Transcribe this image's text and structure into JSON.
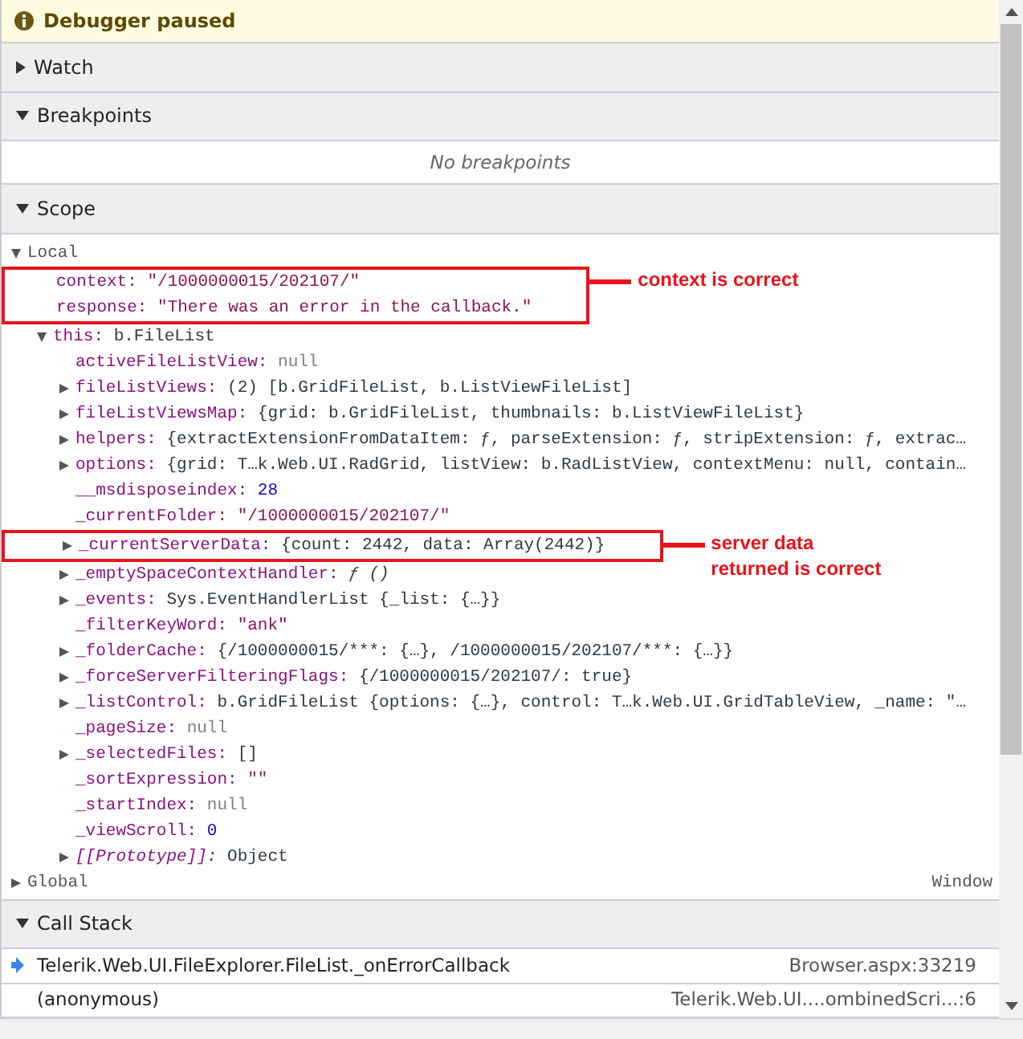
{
  "banner": {
    "text": "Debugger paused"
  },
  "sections": [
    {
      "kind": "watch",
      "title": "Watch",
      "expanded": false
    },
    {
      "kind": "breakpoints",
      "title": "Breakpoints",
      "expanded": true,
      "empty_message": "No breakpoints"
    },
    {
      "kind": "scope",
      "title": "Scope",
      "expanded": true,
      "scopes": [
        {
          "name": "Local",
          "expanded": true,
          "children": [
            {
              "kind": "callout",
              "note": [
                "context is correct"
              ],
              "children": [
                {
                  "kind": "string",
                  "name": "context:",
                  "value": "\"/1000000015/202107/\""
                },
                {
                  "kind": "string",
                  "name": "response:",
                  "value": "\"There was an error in the callback.\""
                }
              ]
            },
            {
              "kind": "object",
              "name": "this:",
              "value": "b.FileList",
              "expanded": true,
              "children": [
                {
                  "kind": "null",
                  "name": "activeFileListView:",
                  "value": "null"
                },
                {
                  "kind": "object",
                  "name": "fileListViews:",
                  "value": "(2) [b.GridFileList, b.ListViewFileList]",
                  "expanded": false
                },
                {
                  "kind": "object",
                  "name": "fileListViewsMap:",
                  "value": "{grid: b.GridFileList, thumbnails: b.ListViewFileList}",
                  "expanded": false
                },
                {
                  "kind": "object",
                  "name": "helpers:",
                  "value": "{extractExtensionFromDataItem: ƒ, parseExtension: ƒ, stripExtension: ƒ, extrac…",
                  "expanded": false
                },
                {
                  "kind": "object",
                  "name": "options:",
                  "value": "{grid: T…k.Web.UI.RadGrid, listView: b.RadListView, contextMenu: null, contain…",
                  "expanded": false
                },
                {
                  "kind": "number",
                  "name": "__msdisposeindex:",
                  "value": "28"
                },
                {
                  "kind": "string",
                  "name": "_currentFolder:",
                  "value": "\"/1000000015/202107/\""
                },
                {
                  "kind": "callout",
                  "note": [
                    "server data",
                    "returned is correct"
                  ],
                  "children": [
                    {
                      "kind": "object",
                      "name": "_currentServerData:",
                      "value": "{count: 2442, data: Array(2442)}",
                      "expanded": false
                    }
                  ]
                },
                {
                  "kind": "function",
                  "name": "_emptySpaceContextHandler:",
                  "value": "ƒ ()",
                  "expanded": false
                },
                {
                  "kind": "object",
                  "name": "_events:",
                  "value": "Sys.EventHandlerList {_list: {…}}",
                  "expanded": false
                },
                {
                  "kind": "string",
                  "name": "_filterKeyWord:",
                  "value": "\"ank\""
                },
                {
                  "kind": "object",
                  "name": "_folderCache:",
                  "value": "{/1000000015/***: {…}, /1000000015/202107/***: {…}}",
                  "expanded": false
                },
                {
                  "kind": "object",
                  "name": "_forceServerFilteringFlags:",
                  "value": "{/1000000015/202107/: true}",
                  "expanded": false
                },
                {
                  "kind": "object",
                  "name": "_listControl:",
                  "value": "b.GridFileList {options: {…}, control: T…k.Web.UI.GridTableView, _name: \"…",
                  "expanded": false
                },
                {
                  "kind": "null",
                  "name": "_pageSize:",
                  "value": "null"
                },
                {
                  "kind": "object",
                  "name": "_selectedFiles:",
                  "value": "[]",
                  "expanded": false
                },
                {
                  "kind": "string",
                  "name": "_sortExpression:",
                  "value": "\"\""
                },
                {
                  "kind": "null",
                  "name": "_startIndex:",
                  "value": "null"
                },
                {
                  "kind": "number",
                  "name": "_viewScroll:",
                  "value": "0"
                },
                {
                  "kind": "prototype",
                  "name": "[[Prototype]]:",
                  "value": "Object",
                  "expanded": false
                }
              ]
            }
          ]
        },
        {
          "name": "Global",
          "expanded": false,
          "value": "Window"
        }
      ]
    },
    {
      "kind": "call_stack",
      "title": "Call Stack",
      "expanded": true,
      "frames": [
        {
          "function": "Telerik.Web.UI.FileExplorer.FileList._onErrorCallback",
          "location": "Browser.aspx:33219",
          "selected": true
        },
        {
          "function": "(anonymous)",
          "location": "Telerik.Web.UI....ombinedScri...:6",
          "selected": false
        }
      ]
    }
  ]
}
